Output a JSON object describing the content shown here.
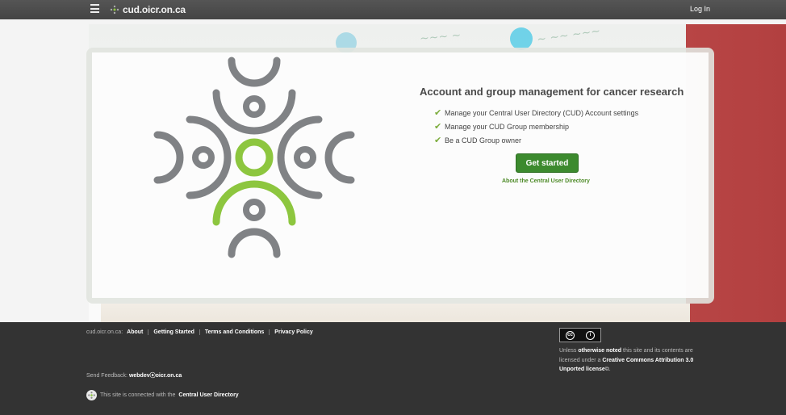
{
  "topbar": {
    "menu_icon": "hamburger-icon",
    "brand": "cud.oicr.on.ca",
    "login": "Log In"
  },
  "hero": {
    "headline": "Account and group management for cancer research",
    "features": [
      "Manage your Central User Directory (CUD) Account settings",
      "Manage your CUD Group membership",
      "Be a CUD Group owner"
    ],
    "cta": "Get started",
    "about_link": "About the Central User Directory",
    "colors": {
      "accent_green": "#3c8a2e",
      "logo_gray": "#808080",
      "logo_green": "#8dc63f"
    }
  },
  "footer": {
    "host": "cud.oicr.on.ca:",
    "links": [
      "About",
      "Getting Started",
      "Terms and Conditions",
      "Privacy Policy"
    ],
    "feedback_label": "Send Feedback:",
    "feedback_email": "webdevⓐoicr.on.ca",
    "connected_prefix": "This site is connected with the",
    "connected_name": "Central User Directory",
    "license_prefix": "Unless",
    "license_bold": "otherwise noted",
    "license_mid": "this site and its contents are licensed under a",
    "license_name": "Creative Commons Attribution 3.0 Unported license",
    "cc_badge": "cc by"
  }
}
